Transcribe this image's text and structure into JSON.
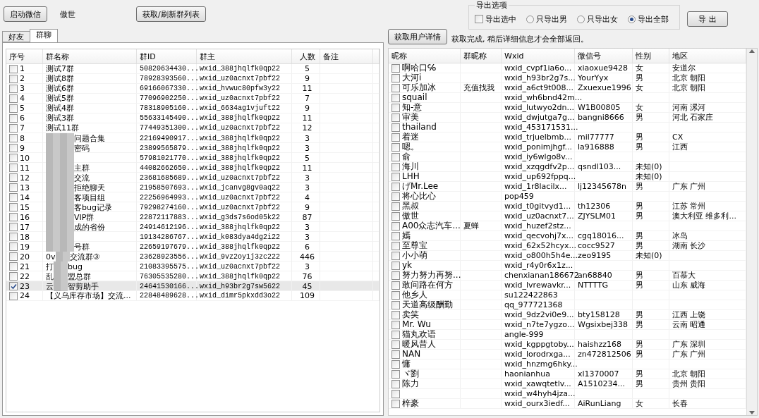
{
  "toolbar": {
    "start_button": "启动微信",
    "account_name": "傲世",
    "refresh_button": "获取/刷新群列表"
  },
  "tabs": [
    {
      "label": "好友",
      "selected": false
    },
    {
      "label": "群聊",
      "selected": true
    }
  ],
  "group_table": {
    "columns": [
      "序号",
      "群名称",
      "群ID",
      "群主",
      "人数",
      "备注"
    ],
    "rows": [
      {
        "no": "1",
        "name": "测试7群",
        "id": "50820634430...",
        "owner": "wxid_388jhqlfk0qp22",
        "count": "5",
        "checked": false,
        "selected": false,
        "masked": false
      },
      {
        "no": "2",
        "name": "测试8群",
        "id": "78928393560...",
        "owner": "wxid_uz0acnxt7pbf22",
        "count": "9",
        "checked": false,
        "selected": false,
        "masked": false
      },
      {
        "no": "3",
        "name": "测试6群",
        "id": "69166067330...",
        "owner": "wxid_hvwuc80pfw3y22",
        "count": "11",
        "checked": false,
        "selected": false,
        "masked": false
      },
      {
        "no": "4",
        "name": "测试5群",
        "id": "77096902250...",
        "owner": "wxid_uz0acnxt7pbf22",
        "count": "7",
        "checked": false,
        "selected": false,
        "masked": false
      },
      {
        "no": "5",
        "name": "测试4群",
        "id": "78318905160...",
        "owner": "wxid_6634ag1vjuft22",
        "count": "9",
        "checked": false,
        "selected": false,
        "masked": false
      },
      {
        "no": "6",
        "name": "测试3群",
        "id": "55633145490...",
        "owner": "wxid_388jhqlfk0qp22",
        "count": "11",
        "checked": false,
        "selected": false,
        "masked": false
      },
      {
        "no": "7",
        "name": "测试11群",
        "id": "77449351300...",
        "owner": "wxid_uz0acnxt7pbf22",
        "count": "12",
        "checked": false,
        "selected": false,
        "masked": false
      },
      {
        "no": "8",
        "name": "问题合集",
        "id": "22169490917...",
        "owner": "wxid_388jhqlfk0qp22",
        "count": "3",
        "checked": false,
        "selected": false,
        "masked": true
      },
      {
        "no": "9",
        "name": "密码",
        "id": "23899565879...",
        "owner": "wxid_388jhqlfk0qp22",
        "count": "3",
        "checked": false,
        "selected": false,
        "masked": true
      },
      {
        "no": "10",
        "id": "57981021770...",
        "owner": "wxid_388jhqlfk0qp22",
        "count": "5",
        "checked": false,
        "selected": false,
        "masked": true
      },
      {
        "no": "11",
        "name": "主群",
        "id": "44082662650...",
        "owner": "wxid_388jhqlfk0qp22",
        "count": "11",
        "checked": false,
        "selected": false,
        "masked": true
      },
      {
        "no": "12",
        "name": "交流",
        "id": "23681685689...",
        "owner": "wxid_uz0acnxt7pbf22",
        "count": "3",
        "checked": false,
        "selected": false,
        "masked": true
      },
      {
        "no": "13",
        "name": "拒绝聊天",
        "id": "21958507693...",
        "owner": "wxid_jcanvg8gv0aq22",
        "count": "3",
        "checked": false,
        "selected": false,
        "masked": true
      },
      {
        "no": "14",
        "name": "客项目组",
        "id": "22256964993...",
        "owner": "wxid_uz0acnxt7pbf22",
        "count": "4",
        "checked": false,
        "selected": false,
        "masked": true
      },
      {
        "no": "15",
        "name": "客bug记录",
        "id": "79298274160...",
        "owner": "wxid_uz0acnxt7pbf22",
        "count": "9",
        "checked": false,
        "selected": false,
        "masked": true
      },
      {
        "no": "16",
        "name": "VIP群",
        "id": "22872117883...",
        "owner": "wxid_g3ds7s6od05k22",
        "count": "87",
        "checked": false,
        "selected": false,
        "masked": true
      },
      {
        "no": "17",
        "name": "成的省份",
        "id": "24914612196...",
        "owner": "wxid_388jhqlfk0qp22",
        "count": "3",
        "checked": false,
        "selected": false,
        "masked": true
      },
      {
        "no": "18",
        "id": "19134286767...",
        "owner": "wxid_k083dya4dg2i22",
        "count": "3",
        "checked": false,
        "selected": false,
        "masked": true
      },
      {
        "no": "19",
        "name": "号群",
        "id": "22659197679...",
        "owner": "wxid_388jhqlfk0qp22",
        "count": "6",
        "checked": false,
        "selected": false,
        "masked": true
      },
      {
        "no": "20",
        "prefix": "0v",
        "name": "交流群③",
        "id": "23628923556...",
        "owner": "wxid_9vz2oy1j3zc222",
        "count": "446",
        "checked": false,
        "selected": false,
        "masked": true
      },
      {
        "no": "21",
        "prefix": "打",
        "name": "bug",
        "id": "21083395575...",
        "owner": "wxid_uz0acnxt7pbf22",
        "count": "3",
        "checked": false,
        "selected": false,
        "masked": true
      },
      {
        "no": "22",
        "prefix": "乱",
        "name": "盟总群",
        "id": "76305535280...",
        "owner": "wxid_388jhqlfk0qp22",
        "count": "76",
        "checked": false,
        "selected": false,
        "masked": true
      },
      {
        "no": "23",
        "prefix": "云",
        "name": "智剪助手",
        "id": "24641530166...",
        "owner": "wxid_h93br2g7sw5622",
        "count": "45",
        "checked": true,
        "selected": true,
        "masked": true
      },
      {
        "no": "24",
        "name": "【义乌库存市场】交流...",
        "id": "22848489628...",
        "owner": "wxid_dimr5pkxdd3o22",
        "count": "109",
        "checked": false,
        "selected": false,
        "masked": false
      }
    ]
  },
  "export_options": {
    "title": "导出选项",
    "export_selected": {
      "label": "导出选中",
      "checked": false
    },
    "radios": [
      {
        "label": "只导出男",
        "selected": false
      },
      {
        "label": "只导出女",
        "selected": false
      },
      {
        "label": "导出全部",
        "selected": true
      }
    ],
    "export_button": "导 出"
  },
  "details_button": "获取用户详情",
  "status_text": "获取完成, 稍后详细信息才会全部返回。",
  "member_table": {
    "columns": [
      "昵称",
      "群昵称",
      "Wxid",
      "微信号",
      "性别",
      "地区"
    ],
    "rows": [
      {
        "nick": "啊哈口℅",
        "wxid": "wxid_cvpf1ia6o...",
        "wechat_id": "xiaoxue9428",
        "gender": "女",
        "region": "安道尔",
        "checked": false
      },
      {
        "nick": "大河i",
        "wxid": "wxid_h93br2g7s...",
        "wechat_id": "YourYyx",
        "gender": "男",
        "region": "北京 朝阳",
        "checked": false
      },
      {
        "nick": "可乐加冰",
        "group_nick": "充值找我",
        "wxid": "wxid_a6ct9t008...",
        "wechat_id": "Zxuexue1996",
        "gender": "女",
        "region": "北京 朝阳",
        "checked": false
      },
      {
        "nick": "squail",
        "wxid": "wxid_wh6bnd42m...",
        "checked": false
      },
      {
        "nick": "知-意",
        "wxid": "wxid_lutwyo2dn...",
        "wechat_id": "W1B00805",
        "gender": "女",
        "region": "河南 漯河",
        "checked": false
      },
      {
        "nick": "审美",
        "wxid": "wxid_dwjutga7g...",
        "wechat_id": "bangni8666",
        "gender": "男",
        "region": "河北 石家庄",
        "checked": false
      },
      {
        "nick": "thailand",
        "wxid": "wxid_453171531...",
        "checked": false
      },
      {
        "nick": "着迷",
        "wxid": "wxid_trjuelbmb...",
        "wechat_id": "mil77777",
        "gender": "男",
        "region": "CX",
        "checked": false
      },
      {
        "nick": "嗯。",
        "wxid": "wxid_ponimjhgf...",
        "wechat_id": "la916888",
        "gender": "男",
        "region": "江西",
        "checked": false
      },
      {
        "nick": "俞",
        "wxid": "wxid_iy6wlgo8v...",
        "checked": false
      },
      {
        "nick": "海川",
        "wxid": "wxid_xzqgdfv2p...",
        "wechat_id": "qsndl103...",
        "gender": "未知(0)",
        "checked": false
      },
      {
        "nick": "LHH",
        "wxid": "wxid_up692fppq...",
        "gender": "未知(0)",
        "checked": false
      },
      {
        "nick": "げMr.Lee",
        "wxid": "wxid_1r8lacilx...",
        "wechat_id": "lj12345678n",
        "gender": "男",
        "region": "广东 广州",
        "checked": false
      },
      {
        "nick": "将心比心",
        "wxid": "pop459",
        "checked": false
      },
      {
        "nick": "黑叔",
        "wxid": "wxid_t0gitvyd1...",
        "wechat_id": "th12306",
        "gender": "男",
        "region": "江苏 常州",
        "checked": false
      },
      {
        "nick": "傲世",
        "wxid": "wxid_uz0acnxt7...",
        "wechat_id": "ZJYSLM01",
        "gender": "男",
        "region": "澳大利亚 维多利...",
        "checked": false
      },
      {
        "nick": "A00众志汽车...",
        "group_nick": "夏蝉",
        "wxid": "wxid_huzef2stz...",
        "checked": false
      },
      {
        "nick": "嫣",
        "wxid": "wxid_qecvohj7x...",
        "wechat_id": "cgq18016...",
        "gender": "男",
        "region": "冰岛",
        "checked": false
      },
      {
        "nick": "至尊宝",
        "wxid": "wxid_62x52hcyx...",
        "wechat_id": "cocc9527",
        "gender": "男",
        "region": "湖南 长沙",
        "checked": false
      },
      {
        "nick": "小小萌",
        "wxid": "wxid_o800h5h4e...",
        "wechat_id": "zeo9195",
        "gender": "未知(0)",
        "checked": false
      },
      {
        "nick": "yk",
        "wxid": "wxid_r4y0r6x1z...",
        "checked": false
      },
      {
        "nick": "努力努力再努...",
        "wxid": "chenxianan186672",
        "wechat_id": "an68840",
        "gender": "男",
        "region": "百慕大",
        "checked": false
      },
      {
        "nick": "敢问路在何方",
        "wxid": "wxid_lvrewavkr...",
        "wechat_id": "NTTTTG",
        "gender": "男",
        "region": "山东 威海",
        "checked": false
      },
      {
        "nick": "他乡人",
        "wxid": "su122422863",
        "checked": false
      },
      {
        "nick": "天道高级酬勤",
        "wxid": "qq_977721368",
        "checked": false
      },
      {
        "nick": "卖笑",
        "wxid": "wxid_9dz2vi0e9...",
        "wechat_id": "bty158128",
        "gender": "男",
        "region": "江西 上饶",
        "checked": false
      },
      {
        "nick": "Mr. Wu",
        "wxid": "wxid_n7te7ygzo...",
        "wechat_id": "Wgsixbej338",
        "gender": "男",
        "region": "云南 昭通",
        "checked": false
      },
      {
        "nick": "猫丸欢语",
        "wxid": "angle-999",
        "checked": false
      },
      {
        "nick": "暖风昔人",
        "wxid": "wxid_kgppgtoby...",
        "wechat_id": "haishzz168",
        "gender": "男",
        "region": "广东 深圳",
        "checked": false
      },
      {
        "nick": "NAN",
        "wxid": "wxid_lorodrxga...",
        "wechat_id": "zn472812506",
        "gender": "男",
        "region": "广东 广州",
        "checked": false
      },
      {
        "nick": "慵",
        "wxid": "wxid_hnzmg6hky...",
        "checked": false
      },
      {
        "nick": "ヾ劉",
        "wxid": "haonianhua",
        "wechat_id": "xl1370007",
        "gender": "男",
        "region": "北京 朝阳",
        "checked": false
      },
      {
        "nick": "陈力",
        "wxid": "wxid_xawqtetlv...",
        "wechat_id": "A1510234...",
        "gender": "男",
        "region": "贵州 贵阳",
        "checked": false
      },
      {
        "wxid": "wxid_w4hyh4jza...",
        "checked": false
      },
      {
        "nick": "梓豪",
        "wxid": "wxid_ourx3iedf...",
        "wechat_id": "AiRunLiang",
        "gender": "女",
        "region": "长春",
        "checked": false
      }
    ]
  }
}
